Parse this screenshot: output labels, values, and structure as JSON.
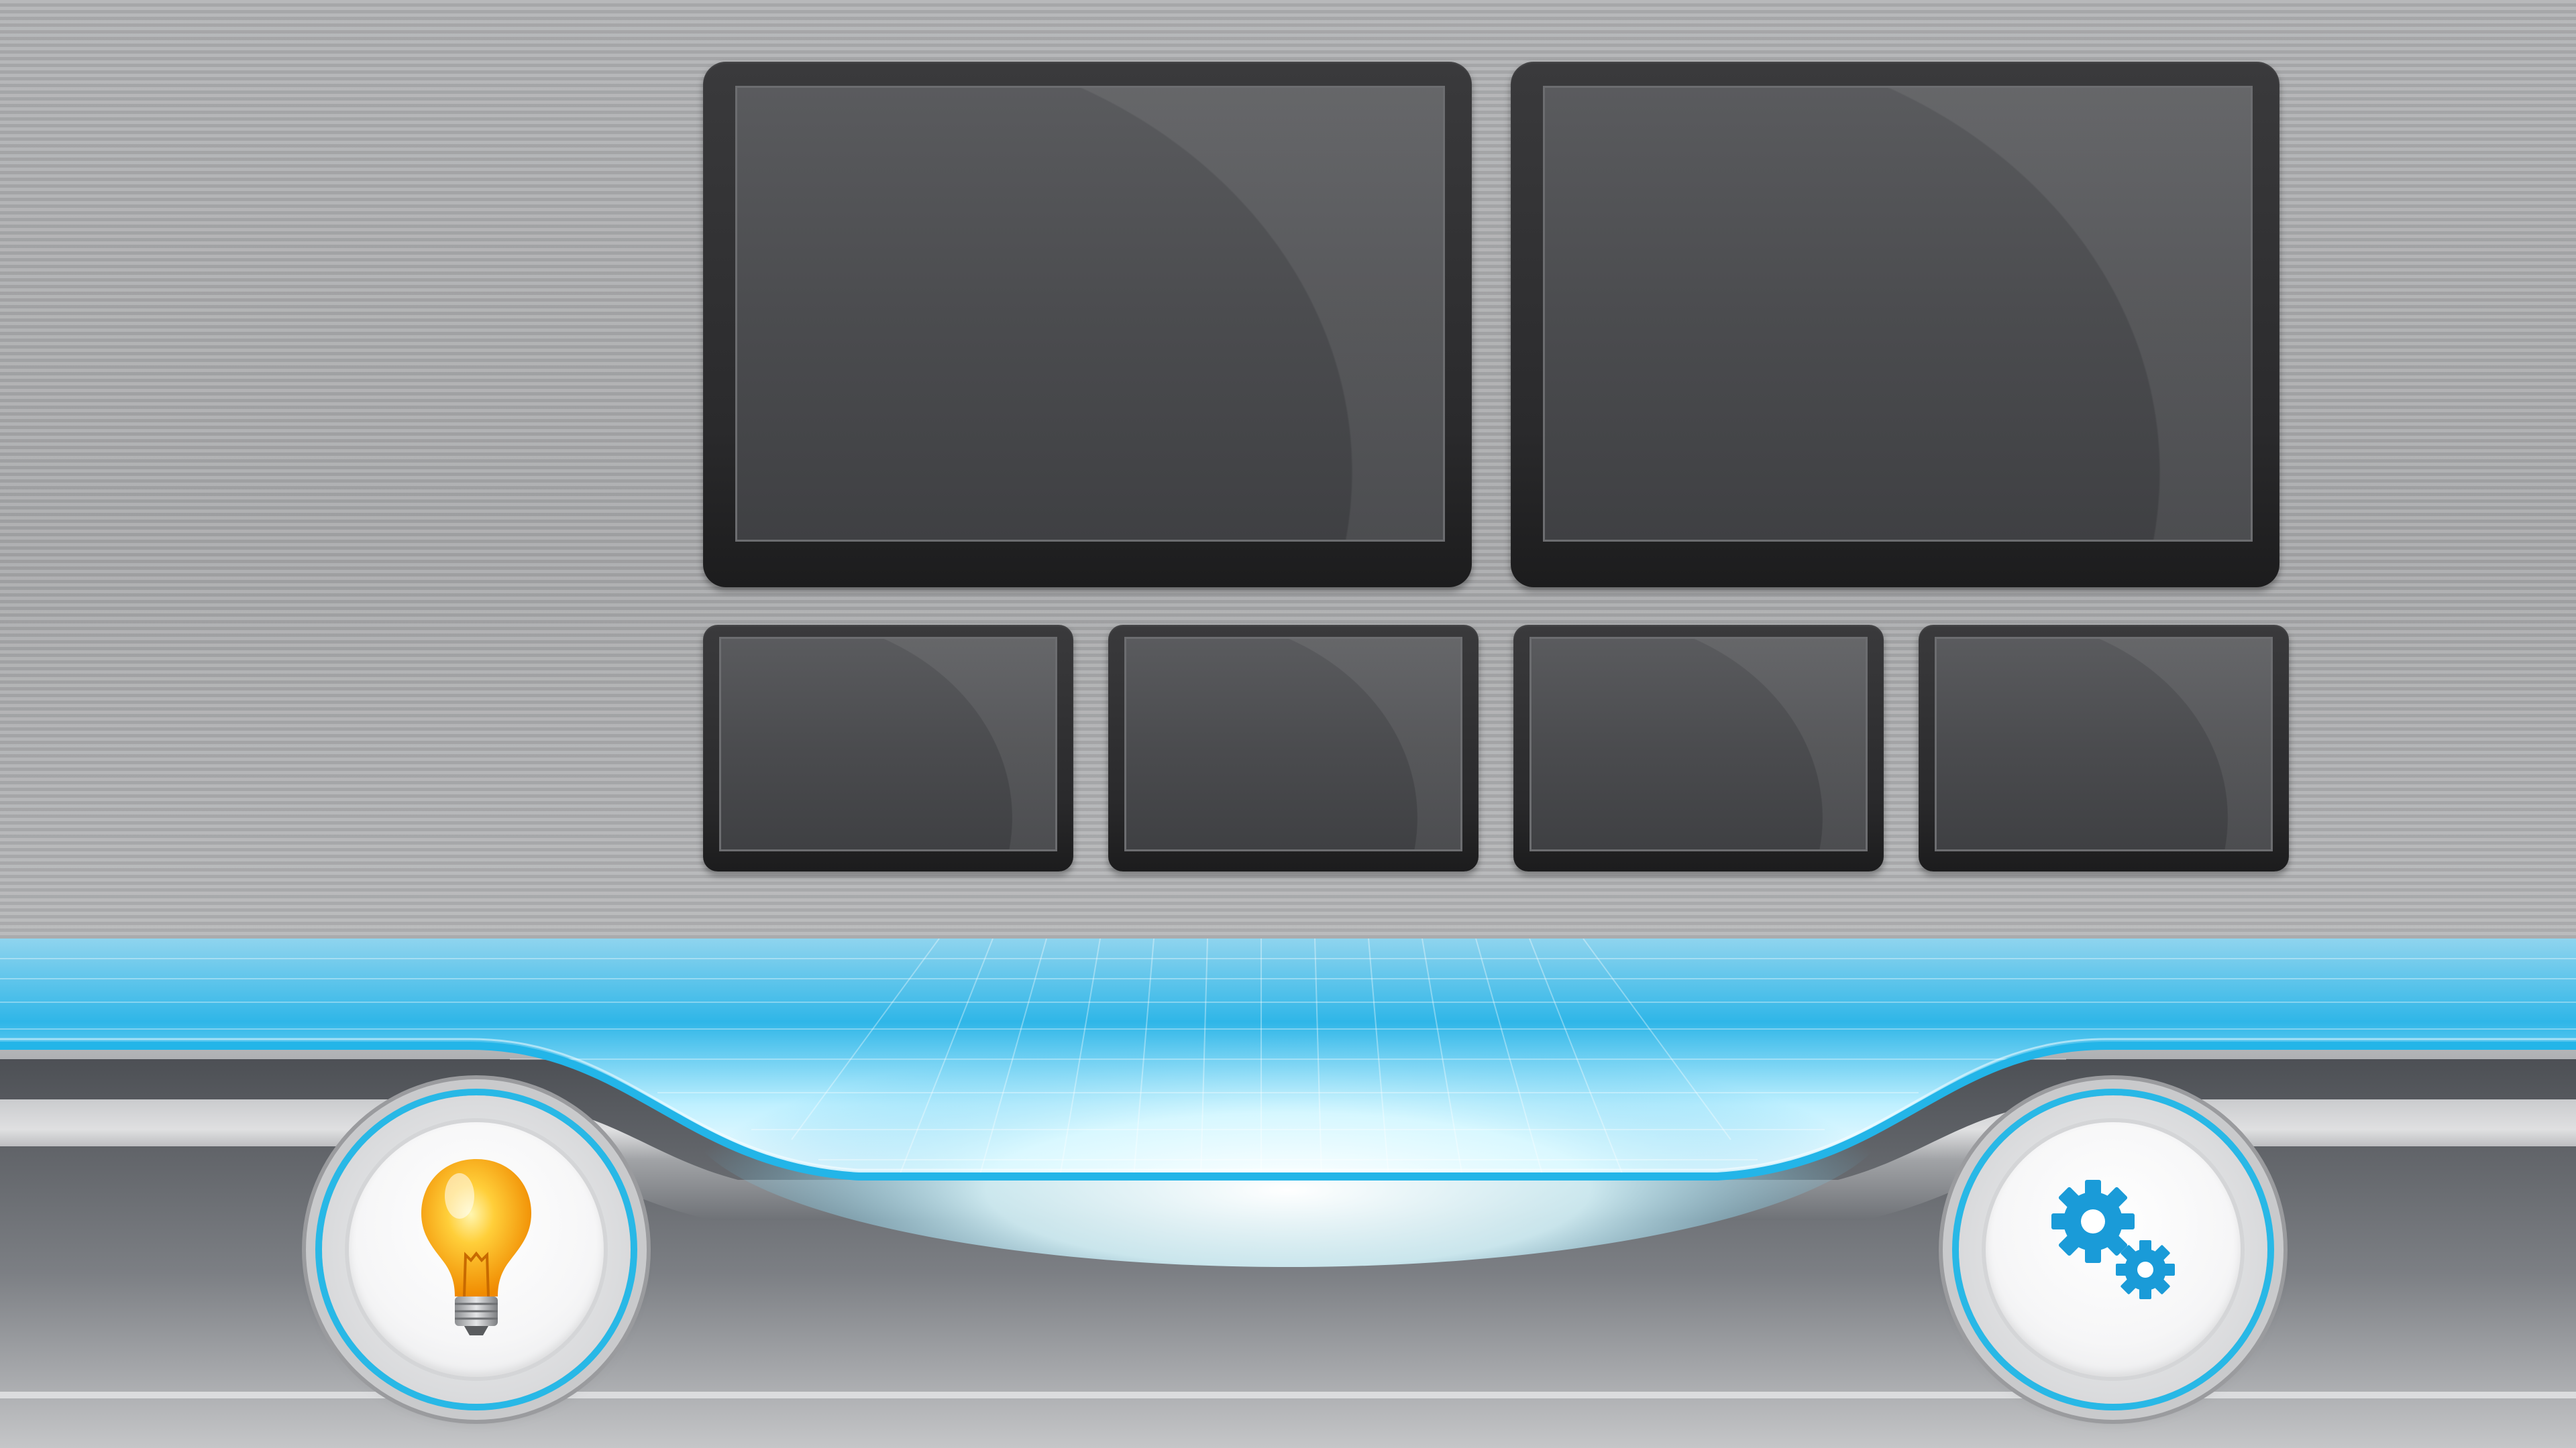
{
  "scene": {
    "monitors_large": [
      {
        "id": "monitor-1"
      },
      {
        "id": "monitor-2"
      }
    ],
    "monitors_small": [
      {
        "id": "monitor-3"
      },
      {
        "id": "monitor-4"
      },
      {
        "id": "monitor-5"
      },
      {
        "id": "monitor-6"
      }
    ]
  },
  "controls": {
    "left_button": {
      "icon": "lightbulb-icon"
    },
    "right_button": {
      "icon": "gears-icon"
    }
  },
  "colors": {
    "accent": "#28b8e6",
    "glow": "#c8f4ff",
    "bulb": "#ffa41c",
    "gear": "#1a9bd8",
    "frame": "#2c2c2e",
    "screen": "#4b4c4f"
  }
}
